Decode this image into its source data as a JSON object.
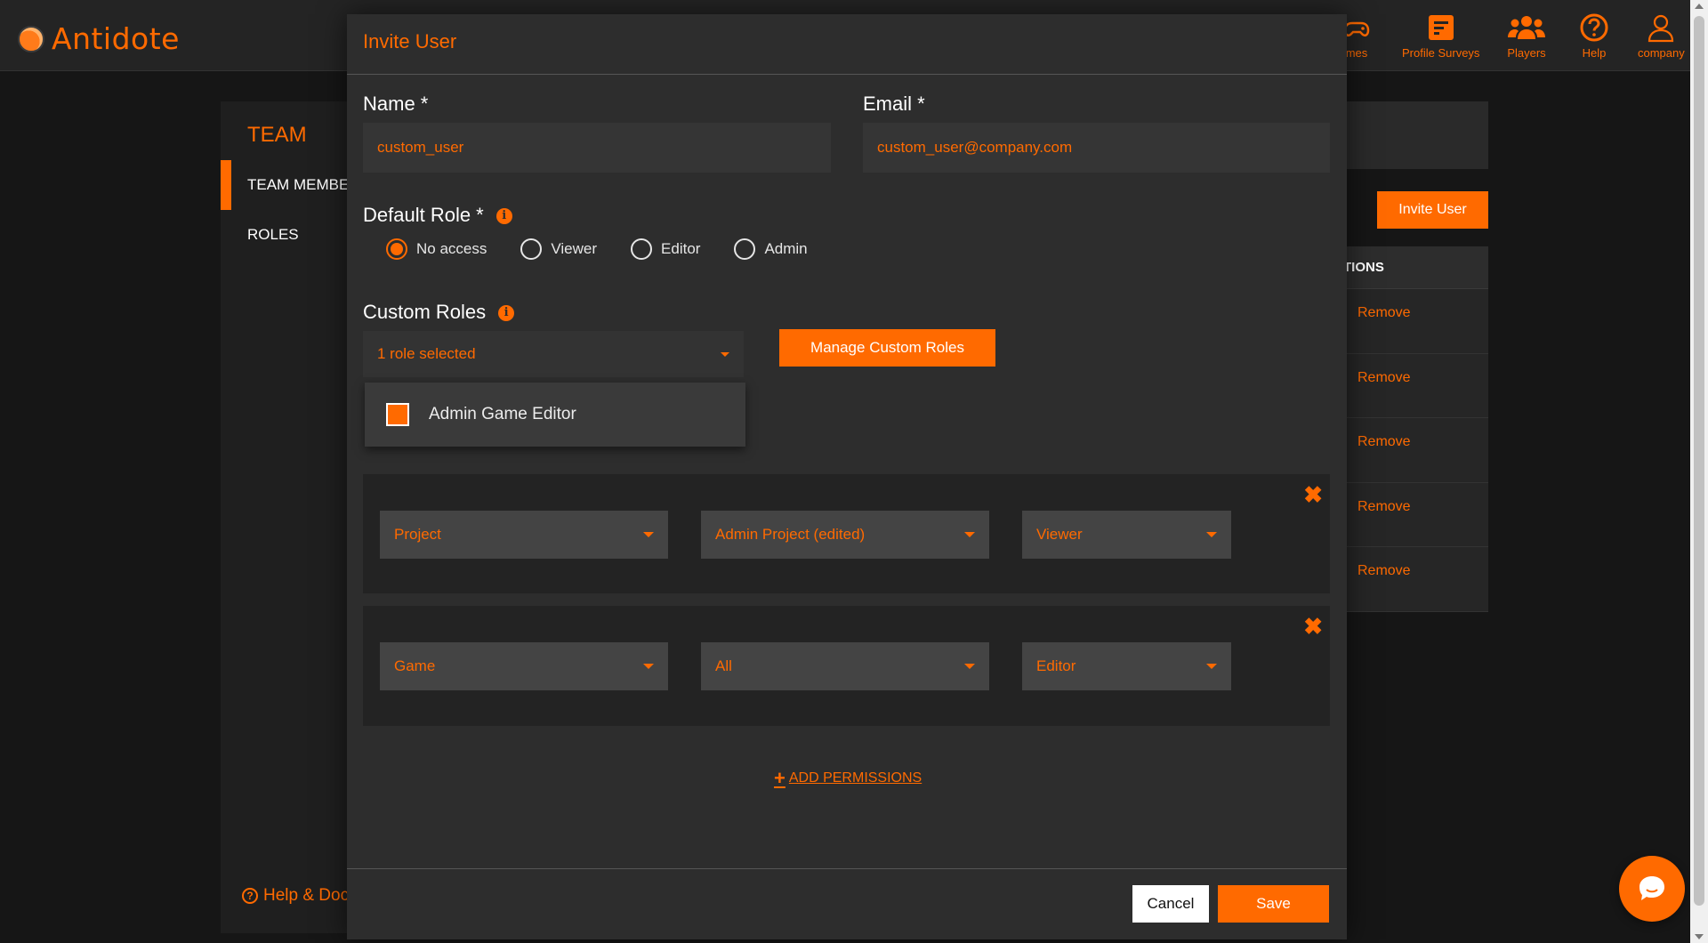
{
  "app": {
    "name": "Antidote"
  },
  "nav": [
    {
      "label": "mes",
      "icon": "gamepad-icon"
    },
    {
      "label": "Profile Surveys",
      "icon": "survey-icon"
    },
    {
      "label": "Players",
      "icon": "players-icon"
    },
    {
      "label": "Help",
      "icon": "help-icon"
    },
    {
      "label": "company",
      "icon": "user-icon"
    }
  ],
  "background": {
    "team_title": "TEAM",
    "team_members": "TEAM MEMBE",
    "roles": "ROLES",
    "help_docs": "Help & Doc",
    "invite_user": "Invite User",
    "table_header": "TIONS",
    "remove_labels": [
      "Remove",
      "Remove",
      "Remove",
      "Remove",
      "Remove"
    ]
  },
  "modal": {
    "title": "Invite User",
    "name_label": "Name *",
    "name_value": "custom_user",
    "email_label": "Email *",
    "email_value": "custom_user@company.com",
    "default_role_label": "Default Role *",
    "roles": [
      {
        "label": "No access",
        "checked": true
      },
      {
        "label": "Viewer",
        "checked": false
      },
      {
        "label": "Editor",
        "checked": false
      },
      {
        "label": "Admin",
        "checked": false
      }
    ],
    "custom_roles_label": "Custom Roles",
    "custom_roles_value": "1 role selected",
    "custom_role_option": "Admin Game Editor",
    "manage_button": "Manage Custom Roles",
    "permissions": [
      {
        "type": "Project",
        "target": "Admin Project (edited)",
        "role": "Viewer"
      },
      {
        "type": "Game",
        "target": "All",
        "role": "Editor"
      }
    ],
    "add_permissions": "ADD PERMISSIONS",
    "cancel": "Cancel",
    "save": "Save"
  },
  "colors": {
    "accent": "#ff6a00",
    "modal_bg": "#2d2d2d",
    "page_bg": "#161616"
  }
}
